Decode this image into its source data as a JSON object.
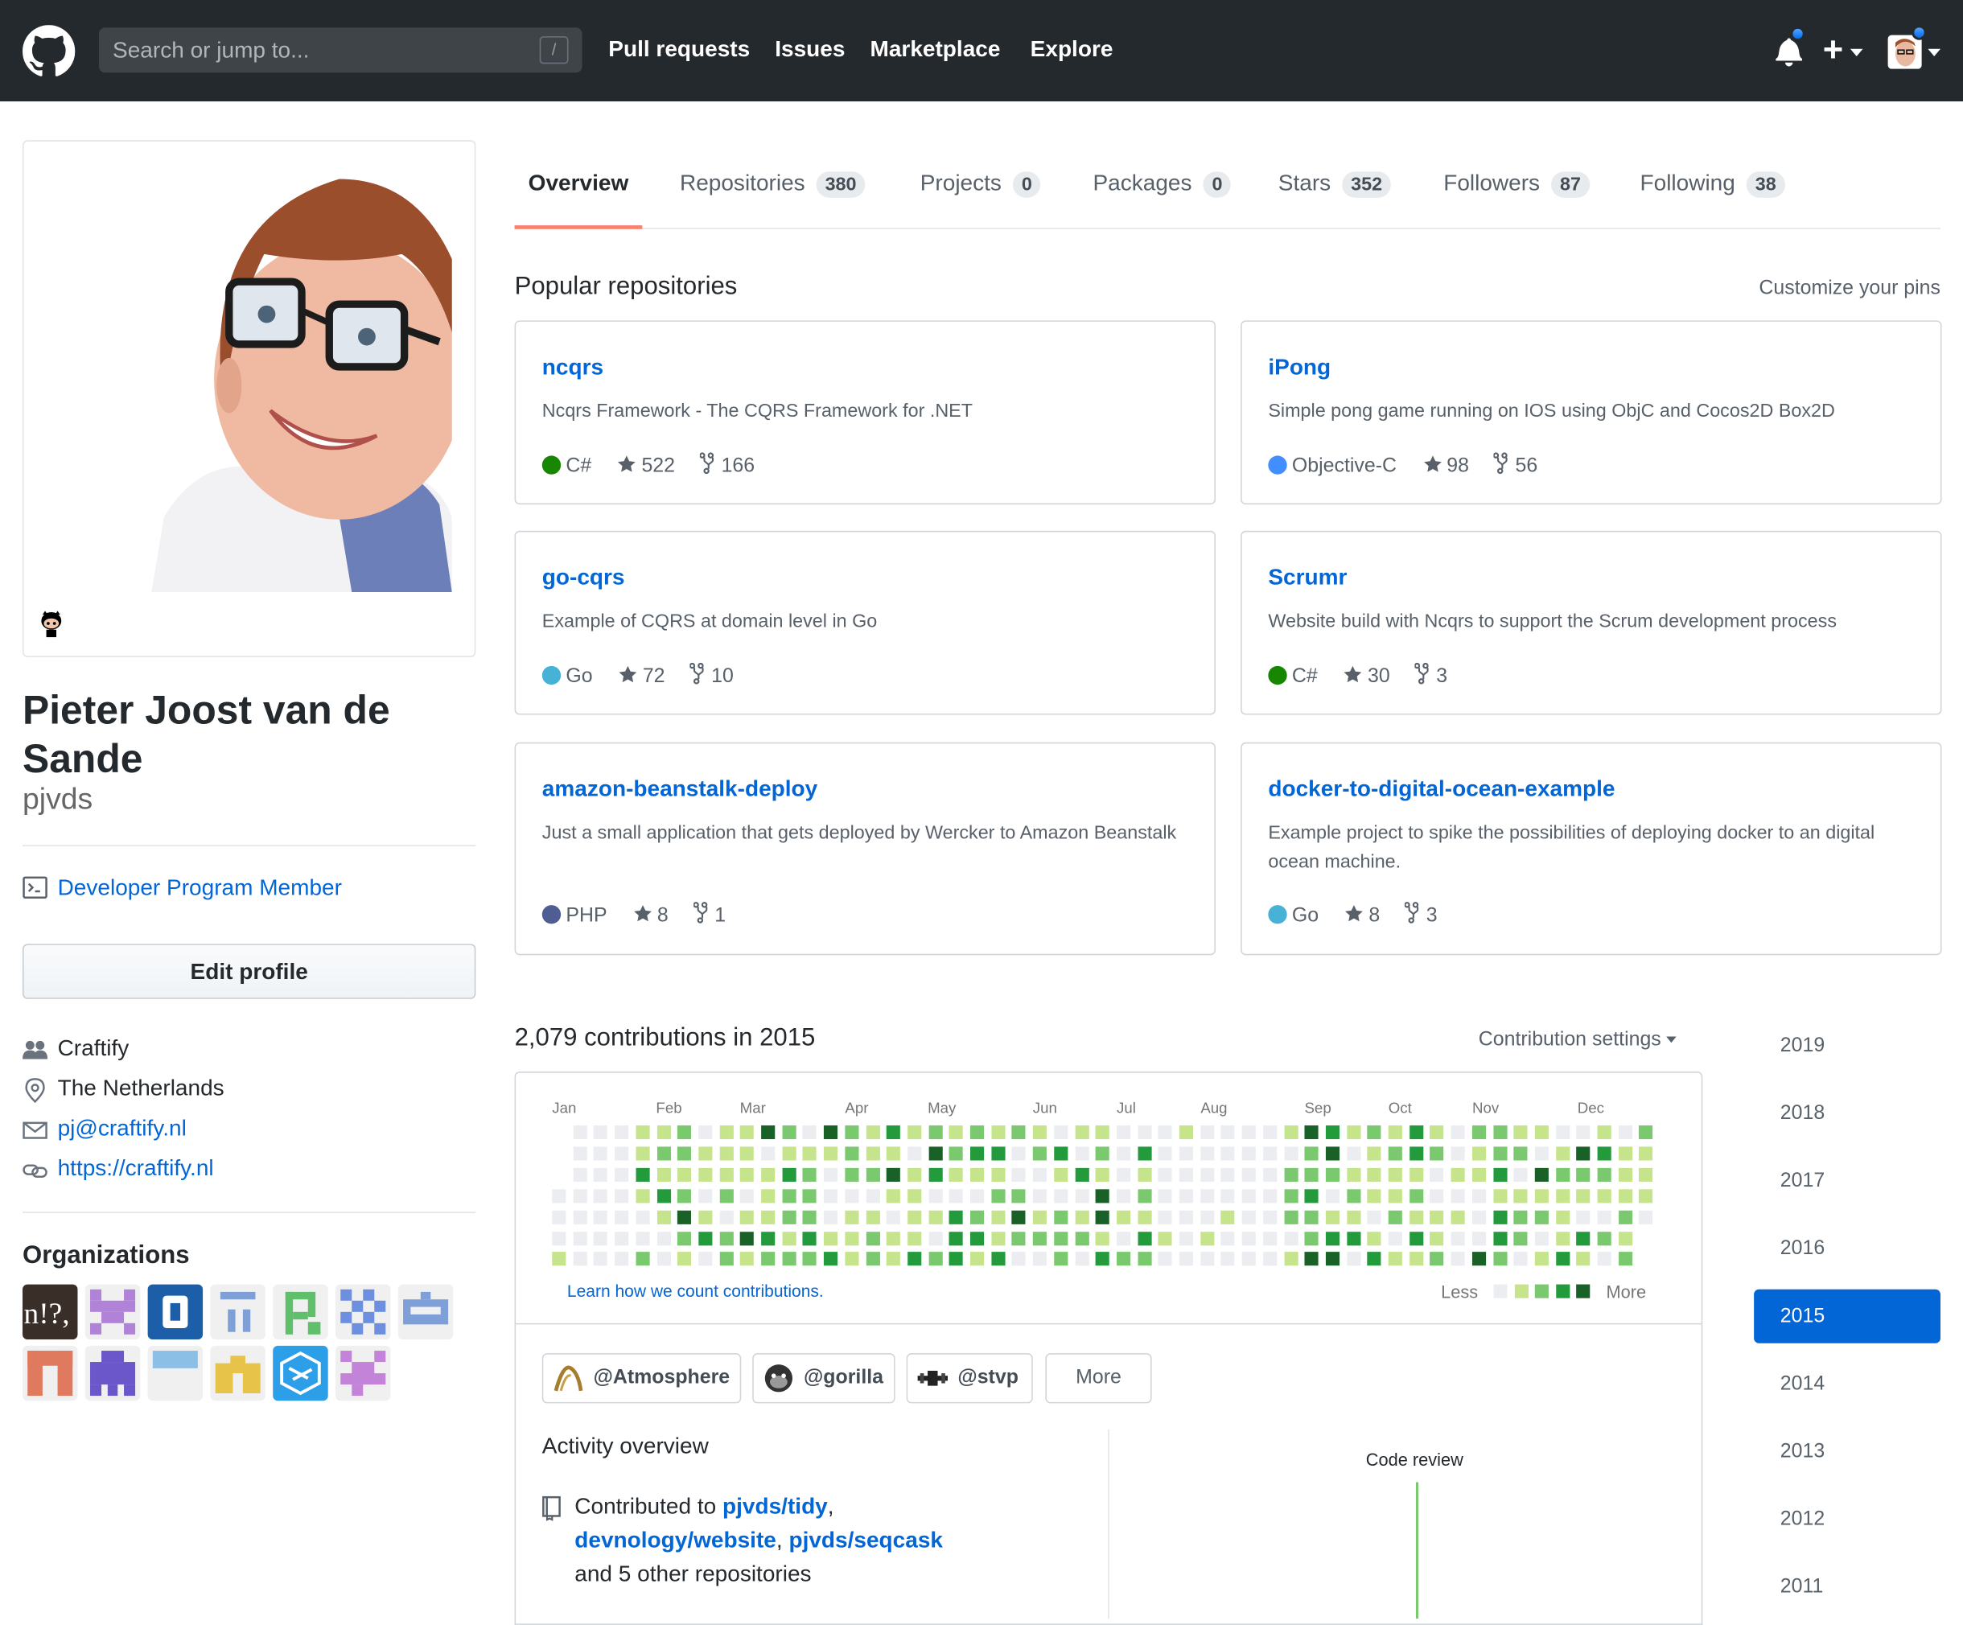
{
  "header": {
    "search_placeholder": "Search or jump to...",
    "search_key": "/",
    "nav": [
      "Pull requests",
      "Issues",
      "Marketplace",
      "Explore"
    ]
  },
  "profile": {
    "name": "Pieter Joost van de Sande",
    "login": "pjvds",
    "badge": "Developer Program Member",
    "edit_button": "Edit profile",
    "company": "Craftify",
    "location": "The Netherlands",
    "email": "pj@craftify.nl",
    "website": "https://craftify.nl",
    "organizations_title": "Organizations"
  },
  "tabs": [
    {
      "label": "Overview",
      "count": ""
    },
    {
      "label": "Repositories",
      "count": "380"
    },
    {
      "label": "Projects",
      "count": "0"
    },
    {
      "label": "Packages",
      "count": "0"
    },
    {
      "label": "Stars",
      "count": "352"
    },
    {
      "label": "Followers",
      "count": "87"
    },
    {
      "label": "Following",
      "count": "38"
    }
  ],
  "popular": {
    "title": "Popular repositories",
    "customize": "Customize your pins",
    "repos": [
      {
        "name": "ncqrs",
        "desc": "Ncqrs Framework - The CQRS Framework for .NET",
        "lang": "C#",
        "lang_color": "#178600",
        "stars": "522",
        "forks": "166"
      },
      {
        "name": "iPong",
        "desc": "Simple pong game running on IOS using ObjC and Cocos2D Box2D",
        "lang": "Objective-C",
        "lang_color": "#438eff",
        "stars": "98",
        "forks": "56"
      },
      {
        "name": "go-cqrs",
        "desc": "Example of CQRS at domain level in Go",
        "lang": "Go",
        "lang_color": "#48b1d6",
        "stars": "72",
        "forks": "10"
      },
      {
        "name": "Scrumr",
        "desc": "Website build with Ncqrs to support the Scrum development process",
        "lang": "C#",
        "lang_color": "#178600",
        "stars": "30",
        "forks": "3"
      },
      {
        "name": "amazon-beanstalk-deploy",
        "desc": "Just a small application that gets deployed by Wercker to Amazon Beanstalk",
        "lang": "PHP",
        "lang_color": "#4f5d95",
        "stars": "8",
        "forks": "1"
      },
      {
        "name": "docker-to-digital-ocean-example",
        "desc": "Example project to spike the possibilities of deploying docker to an digital ocean machine.",
        "lang": "Go",
        "lang_color": "#48b1d6",
        "stars": "8",
        "forks": "3"
      }
    ]
  },
  "contributions": {
    "title": "2,079 contributions in 2015",
    "settings": "Contribution settings",
    "months": [
      "Jan",
      "Feb",
      "Mar",
      "Apr",
      "May",
      "Jun",
      "Jul",
      "Aug",
      "Sep",
      "Oct",
      "Nov",
      "Dec"
    ],
    "learn_link": "Learn how we count contributions.",
    "legend_less": "Less",
    "legend_more": "More",
    "colors": [
      "#ebedf0",
      "#c6e48b",
      "#7bc96f",
      "#239a3b",
      "#196127"
    ]
  },
  "activity": {
    "orgs": [
      "@Atmosphere",
      "@gorilla",
      "@stvp"
    ],
    "more": "More",
    "title": "Activity overview",
    "contributed_prefix": "Contributed to",
    "repos": [
      "pjvds/tidy",
      "devnology/website",
      "pjvds/seqcask"
    ],
    "suffix": "and 5 other repositories",
    "code_review": "Code review"
  },
  "years": [
    "2019",
    "2018",
    "2017",
    "2016",
    "2015",
    "2014",
    "2013",
    "2012",
    "2011"
  ],
  "selected_year": "2015"
}
